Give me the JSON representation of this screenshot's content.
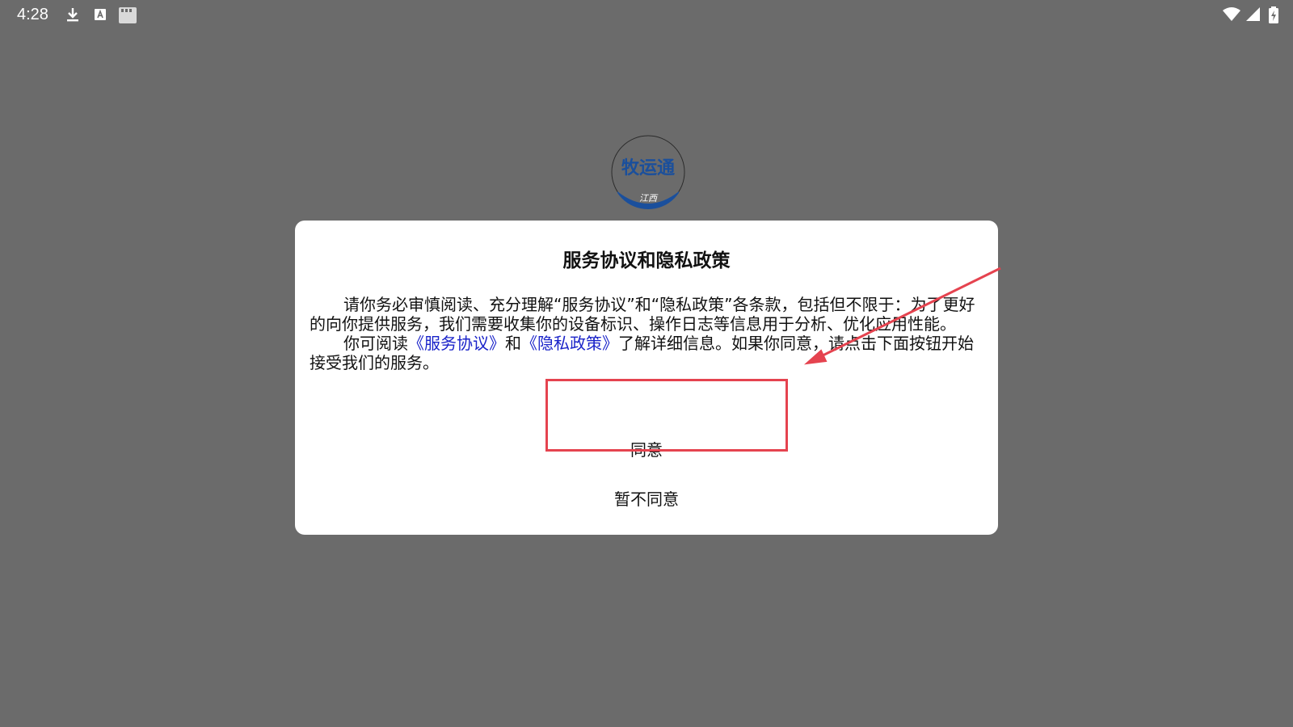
{
  "status_bar": {
    "time": "4:28",
    "left_icons": [
      "download-icon",
      "keyboard-a-icon",
      "sd-card-icon"
    ],
    "right_icons": [
      "wifi-icon",
      "cell-signal-icon",
      "battery-charging-icon"
    ]
  },
  "app_logo": {
    "name": "牧运通",
    "region": "江西"
  },
  "dialog": {
    "title": "服务协议和隐私政策",
    "paragraph1": "请你务必审慎阅读、充分理解“服务协议”和“隐私政策”各条款，包括但不限于：为了更好的向你提供服务，我们需要收集你的设备标识、操作日志等信息用于分析、优化应用性能。",
    "paragraph2_prefix": "你可阅读",
    "link_service": "《服务协议》",
    "paragraph2_and": "和",
    "link_privacy": "《隐私政策》",
    "paragraph2_suffix": "了解详细信息。如果你同意，请点击下面按钮开始接受我们的服务。",
    "agree_label": "同意",
    "disagree_label": "暂不同意"
  },
  "colors": {
    "overlay": "#6b6b6b",
    "link": "#1a23c9",
    "annotation": "#e5434f",
    "logo_blue": "#1a4f9c"
  }
}
